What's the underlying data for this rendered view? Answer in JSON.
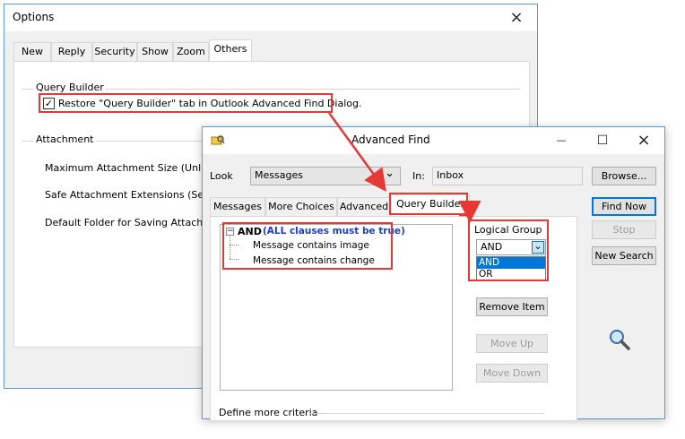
{
  "options": {
    "title": "Options",
    "tabs": [
      "New",
      "Reply",
      "Security",
      "Show",
      "Zoom",
      "Others"
    ],
    "query_builder_group": "Query Builder",
    "restore_checkbox_label": "Restore \"Query Builder\" tab in Outlook Advanced Find Dialog.",
    "attachment_group": "Attachment",
    "max_size_label": "Maximum Attachment Size (Unlimited",
    "safe_ext_label": "Safe Attachment Extensions (Separa",
    "default_folder_label": "Default Folder for Saving Attachmen"
  },
  "advanced_find": {
    "title": "Advanced Find",
    "look_label": "Look",
    "look_value": "Messages",
    "in_label": "In:",
    "in_value": "Inbox",
    "browse_label": "Browse...",
    "tabs": [
      "Messages",
      "More Choices",
      "Advanced",
      "Query Builder"
    ],
    "tree": {
      "root_op": "AND",
      "root_note": "(ALL clauses must be true)",
      "children": [
        "Message contains image",
        "Message contains change"
      ]
    },
    "logical_group_label": "Logical Group",
    "logical_group_value": "AND",
    "logical_options": [
      "AND",
      "OR"
    ],
    "remove_item": "Remove Item",
    "move_up": "Move Up",
    "move_down": "Move Down",
    "define_more": "Define more criteria",
    "find_now": "Find Now",
    "stop": "Stop",
    "new_search": "New Search"
  },
  "icons": {
    "close": "×",
    "maximize": "☐",
    "minimize": "—",
    "dropdown": "⌄"
  },
  "colors": {
    "highlight_red": "#e53935",
    "selection_blue": "#0078d7",
    "clause_note_blue": "#1a3fc4"
  }
}
